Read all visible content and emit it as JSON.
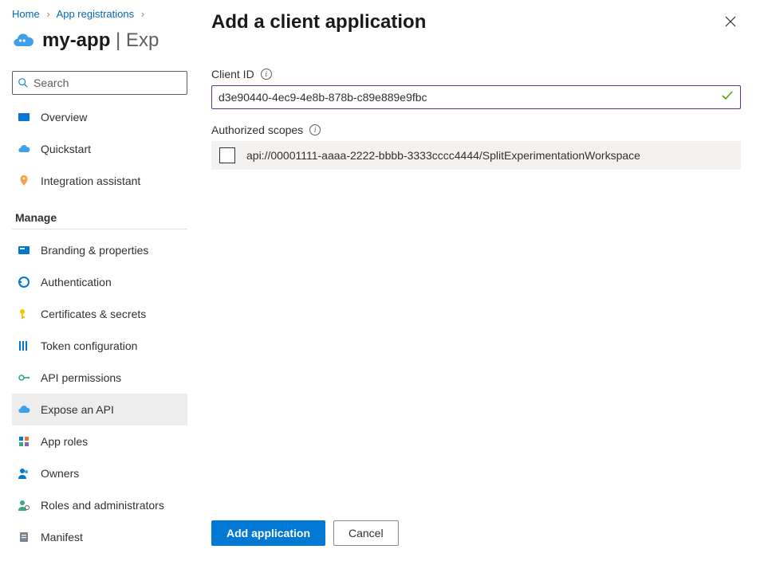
{
  "breadcrumb": {
    "home": "Home",
    "registrations": "App registrations"
  },
  "header": {
    "app_name": "my-app",
    "suffix": " | Exp"
  },
  "search": {
    "placeholder": "Search"
  },
  "nav": {
    "overview": "Overview",
    "quickstart": "Quickstart",
    "integration_assistant": "Integration assistant",
    "manage_label": "Manage",
    "branding": "Branding & properties",
    "authentication": "Authentication",
    "certificates": "Certificates & secrets",
    "token_config": "Token configuration",
    "api_permissions": "API permissions",
    "expose_api": "Expose an API",
    "app_roles": "App roles",
    "owners": "Owners",
    "roles_admins": "Roles and administrators",
    "manifest": "Manifest"
  },
  "panel": {
    "title": "Add a client application",
    "client_id_label": "Client ID",
    "client_id_value": "d3e90440-4ec9-4e8b-878b-c89e889e9fbc",
    "scopes_label": "Authorized scopes",
    "scope_value": "api://00001111-aaaa-2222-bbbb-3333cccc4444/SplitExperimentationWorkspace",
    "add_button": "Add application",
    "cancel_button": "Cancel"
  }
}
